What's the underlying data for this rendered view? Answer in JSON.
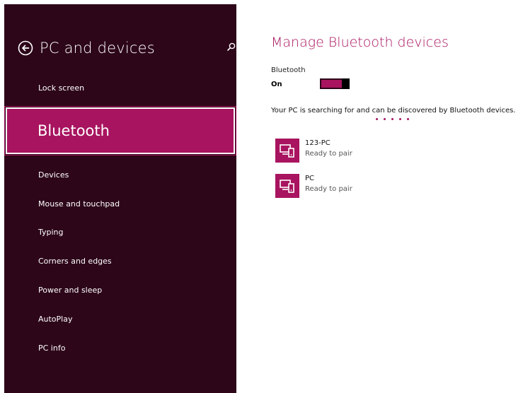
{
  "sidebar": {
    "title": "PC and devices",
    "items": [
      {
        "label": "Lock screen"
      },
      {
        "label": "Bluetooth"
      },
      {
        "label": "Devices"
      },
      {
        "label": "Mouse and touchpad"
      },
      {
        "label": "Typing"
      },
      {
        "label": "Corners and edges"
      },
      {
        "label": "Power and sleep"
      },
      {
        "label": "AutoPlay"
      },
      {
        "label": "PC info"
      }
    ],
    "selected": "Bluetooth"
  },
  "main": {
    "title": "Manage Bluetooth devices",
    "bluetooth_label": "Bluetooth",
    "bluetooth_state": "On",
    "status": "Your PC is searching for and can be discovered by Bluetooth devices.",
    "devices": [
      {
        "name": "123-PC",
        "status": "Ready to pair"
      },
      {
        "name": "PC",
        "status": "Ready to pair"
      }
    ]
  },
  "colors": {
    "accent": "#a8145f",
    "sidebar_bg": "#2d0619"
  },
  "icons": {
    "back": "back-arrow-icon",
    "search": "search-icon",
    "device": "device-icon"
  }
}
